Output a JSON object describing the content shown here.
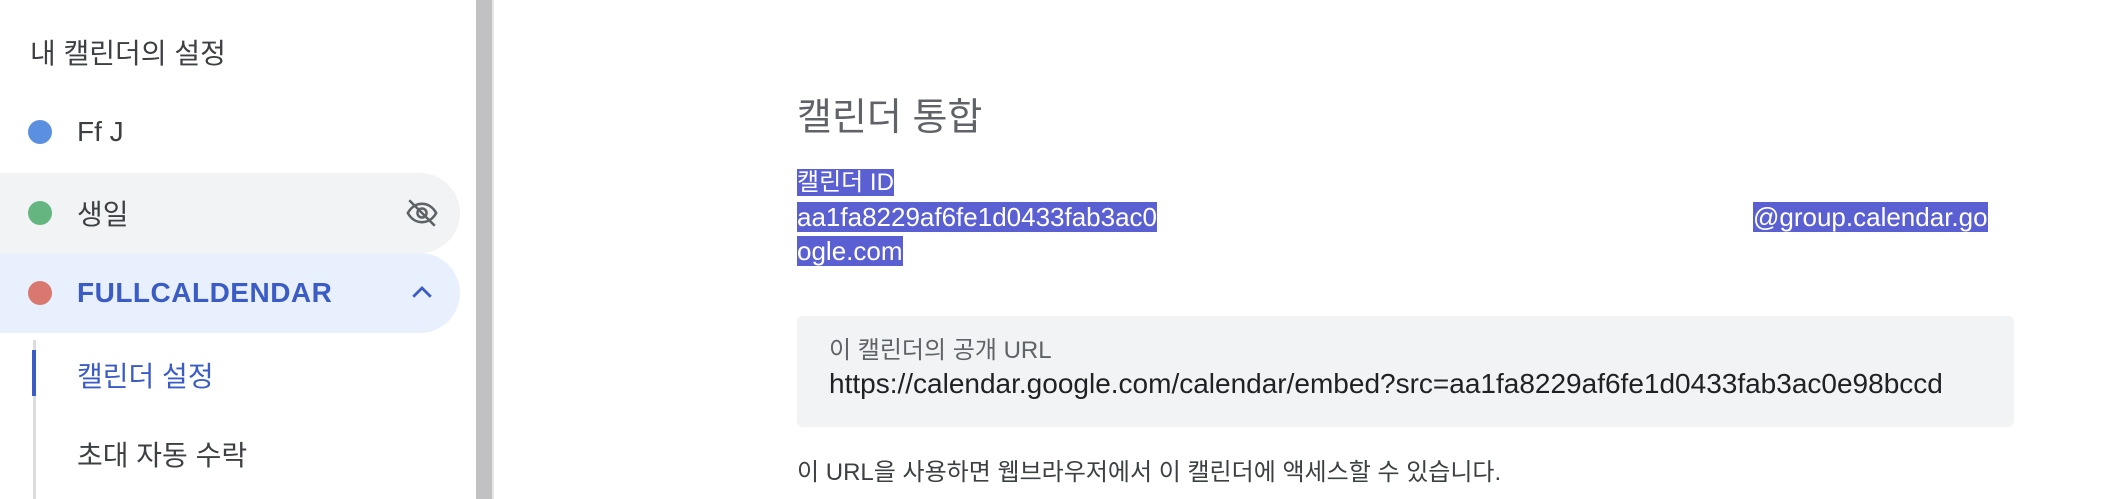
{
  "sidebar": {
    "heading": "내 캘린더의 설정",
    "calendars": [
      {
        "name": "Ff J",
        "color": "#5b8fe0"
      },
      {
        "name": "생일",
        "color": "#64b57f"
      },
      {
        "name": "FULLCALDENDAR",
        "color": "#d9786e"
      }
    ],
    "sub_items": [
      "캘린더 설정",
      "초대 자동 수락"
    ]
  },
  "main": {
    "section_title": "캘린더 통합",
    "calendar_id_label": "캘린더 ID",
    "calendar_id_part1": "aa1fa8229af6fe1d0433fab3ac0",
    "calendar_id_part2": "@group.calendar.go",
    "calendar_id_part3": "ogle.com",
    "public_url_label": "이 캘린더의 공개 URL",
    "public_url_value": "https://calendar.google.com/calendar/embed?src=aa1fa8229af6fe1d0433fab3ac0e98bccd",
    "helper_text": "이 URL을 사용하면 웹브라우저에서 이 캘린더에 액세스할 수 있습니다."
  },
  "colors": {
    "accent": "#3b5cc4",
    "selection": "#5a5fd1"
  }
}
